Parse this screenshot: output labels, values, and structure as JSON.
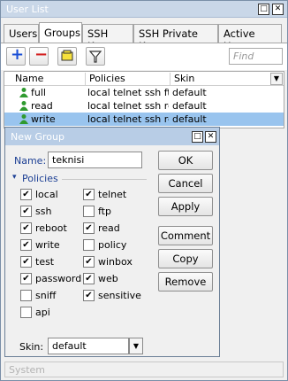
{
  "window": {
    "title": "User List",
    "restore_glyph": "□",
    "close_glyph": "✕"
  },
  "tabs": [
    {
      "label": "Users"
    },
    {
      "label": "Groups"
    },
    {
      "label": "SSH Keys"
    },
    {
      "label": "SSH Private Keys"
    },
    {
      "label": "Active Users"
    }
  ],
  "toolbar": {
    "add_glyph": "+",
    "remove_glyph": "−",
    "find_placeholder": "Find",
    "dropdown_glyph": "▼"
  },
  "table": {
    "columns": [
      "Name",
      "Policies",
      "Skin"
    ],
    "rows": [
      {
        "name": "full",
        "policies": "local telnet ssh ft...",
        "skin": "default"
      },
      {
        "name": "read",
        "policies": "local telnet ssh re...",
        "skin": "default"
      },
      {
        "name": "write",
        "policies": "local telnet ssh re...",
        "skin": "default"
      }
    ]
  },
  "dialog": {
    "title": "New Group",
    "name_label": "Name:",
    "name_value": "teknisi",
    "policies_label": "Policies",
    "policies": [
      {
        "label": "local",
        "checked": true
      },
      {
        "label": "telnet",
        "checked": true
      },
      {
        "label": "ssh",
        "checked": true
      },
      {
        "label": "ftp",
        "checked": false
      },
      {
        "label": "reboot",
        "checked": true
      },
      {
        "label": "read",
        "checked": true
      },
      {
        "label": "write",
        "checked": true
      },
      {
        "label": "policy",
        "checked": false
      },
      {
        "label": "test",
        "checked": true
      },
      {
        "label": "winbox",
        "checked": true
      },
      {
        "label": "password",
        "checked": true
      },
      {
        "label": "web",
        "checked": true
      },
      {
        "label": "sniff",
        "checked": false
      },
      {
        "label": "sensitive",
        "checked": true
      },
      {
        "label": "api",
        "checked": false
      }
    ],
    "skin_label": "Skin:",
    "skin_value": "default",
    "buttons": {
      "ok": "OK",
      "cancel": "Cancel",
      "apply": "Apply",
      "comment": "Comment",
      "copy": "Copy",
      "remove": "Remove"
    },
    "check_glyph": "✔",
    "collapse_glyph": "▾",
    "select_glyph": "▼"
  },
  "status": {
    "text": "System"
  },
  "colors": {
    "accent": "#1c3f94",
    "selection": "#99c4ee",
    "add": "#1a4fd6",
    "remove": "#d32020",
    "user_icon": "#2f9a2f"
  }
}
